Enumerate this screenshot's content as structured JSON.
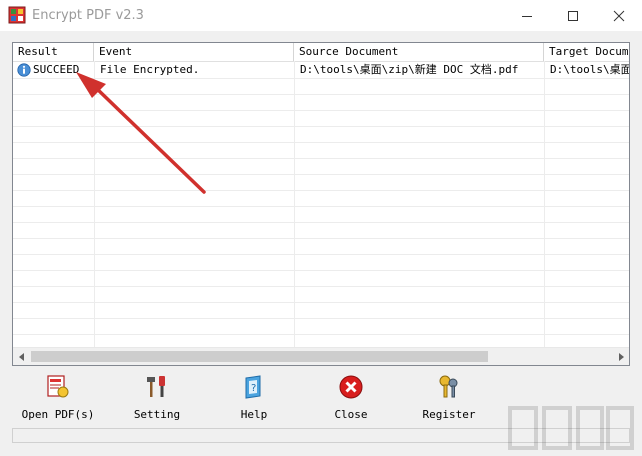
{
  "window": {
    "title": "Encrypt PDF v2.3",
    "controls": [
      "minimize",
      "maximize",
      "close"
    ]
  },
  "table": {
    "columns": [
      "Result",
      "Event",
      "Source Document",
      "Target Docume"
    ],
    "rows": [
      {
        "result": "SUCCEED",
        "event": "File Encrypted.",
        "source": "D:\\tools\\桌面\\zip\\新建 DOC 文档.pdf",
        "target": "D:\\tools\\桌面\\"
      }
    ]
  },
  "toolbar": {
    "open_label": "Open PDF(s)",
    "setting_label": "Setting",
    "help_label": "Help",
    "close_label": "Close",
    "register_label": "Register"
  },
  "colors": {
    "annotation_arrow": "#d0312d",
    "close_icon": "#d81e1e"
  }
}
